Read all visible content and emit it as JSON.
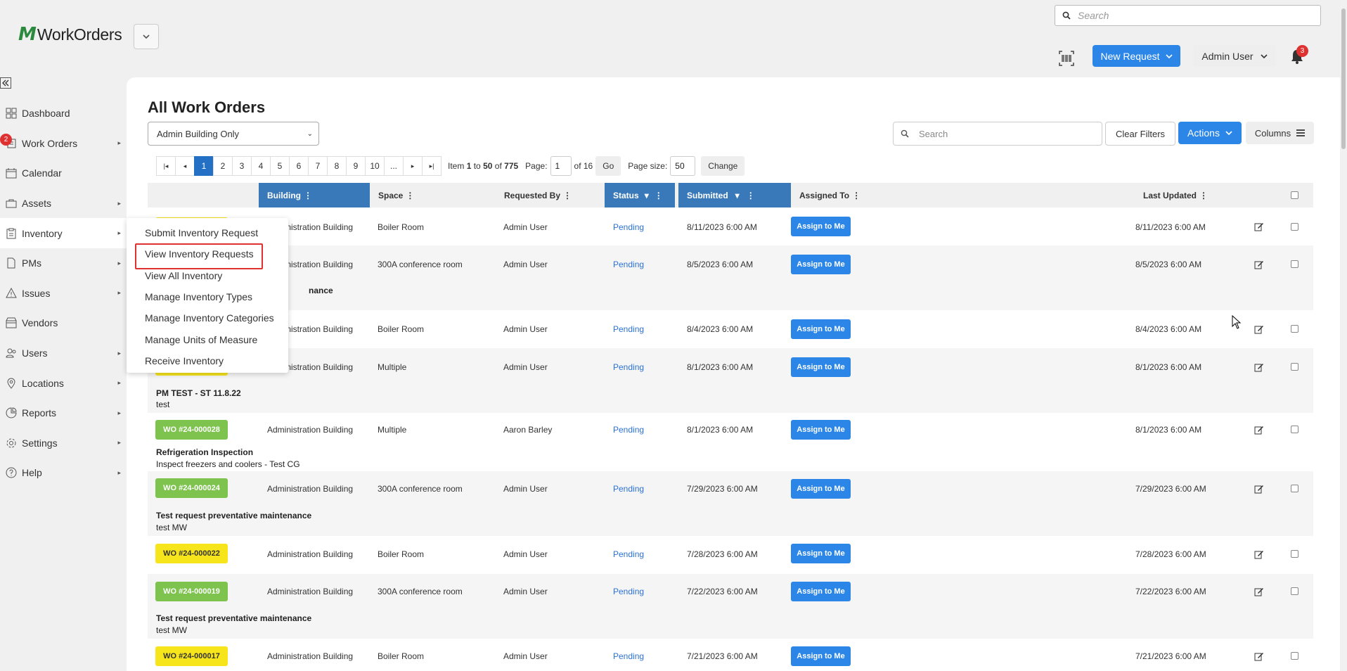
{
  "header": {
    "app_name": "WorkOrders",
    "logo_mark": "M",
    "search_placeholder": "Search",
    "new_request_label": "New Request",
    "user_label": "Admin User",
    "notification_count": "3"
  },
  "sidebar": {
    "items": [
      {
        "label": "Dashboard",
        "icon": "dashboard-icon",
        "arrow": false
      },
      {
        "label": "Work Orders",
        "icon": "work-orders-icon",
        "arrow": true,
        "badge": "2"
      },
      {
        "label": "Calendar",
        "icon": "calendar-icon",
        "arrow": false
      },
      {
        "label": "Assets",
        "icon": "assets-icon",
        "arrow": true
      },
      {
        "label": "Inventory",
        "icon": "inventory-icon",
        "arrow": true,
        "active": true
      },
      {
        "label": "PMs",
        "icon": "pms-icon",
        "arrow": true
      },
      {
        "label": "Issues",
        "icon": "issues-icon",
        "arrow": true
      },
      {
        "label": "Vendors",
        "icon": "vendors-icon",
        "arrow": false
      },
      {
        "label": "Users",
        "icon": "users-icon",
        "arrow": true
      },
      {
        "label": "Locations",
        "icon": "locations-icon",
        "arrow": true
      },
      {
        "label": "Reports",
        "icon": "reports-icon",
        "arrow": true
      },
      {
        "label": "Settings",
        "icon": "settings-icon",
        "arrow": true
      },
      {
        "label": "Help",
        "icon": "help-icon",
        "arrow": true
      }
    ]
  },
  "inventory_menu": {
    "items": [
      {
        "label": "Submit Inventory Request"
      },
      {
        "label": "View Inventory Requests",
        "highlighted": true
      },
      {
        "label": "View All Inventory"
      },
      {
        "label": "Manage Inventory Types"
      },
      {
        "label": "Manage Inventory Categories"
      },
      {
        "label": "Manage Units of Measure"
      },
      {
        "label": "Receive Inventory"
      }
    ]
  },
  "main": {
    "title": "All Work Orders",
    "filter_selected": "Admin Building Only",
    "search_placeholder": "Search",
    "clear_filters_label": "Clear Filters",
    "actions_label": "Actions",
    "columns_label": "Columns"
  },
  "pager": {
    "first": "|◂",
    "prev": "◂",
    "pages": [
      "1",
      "2",
      "3",
      "4",
      "5",
      "6",
      "7",
      "8",
      "9",
      "10",
      "..."
    ],
    "next": "▸",
    "last": "▸|",
    "item_prefix": "Item",
    "item_from": "1",
    "item_to_word": "to",
    "item_to": "50",
    "item_of_word": "of",
    "item_total": "775",
    "page_label": "Page:",
    "page_value": "1",
    "page_of": "of 16",
    "go_label": "Go",
    "size_label": "Page size:",
    "size_value": "50",
    "change_label": "Change"
  },
  "table": {
    "headers": {
      "building": "Building",
      "space": "Space",
      "requested_by": "Requested By",
      "status": "Status",
      "submitted": "Submitted",
      "assigned_to": "Assigned To",
      "last_updated": "Last Updated"
    },
    "assign_label": "Assign to Me",
    "rows": [
      {
        "wo": "",
        "badge_color": "yellow",
        "building": "Administration Building",
        "space": "Boiler Room",
        "requested_by": "Admin User",
        "status": "Pending",
        "submitted": "8/11/2023 6:00 AM",
        "last_updated": "8/11/2023 6:00 AM",
        "title": "",
        "desc": ""
      },
      {
        "wo": "",
        "badge_color": "none",
        "building": "Administration Building",
        "space": "300A conference room",
        "requested_by": "Admin User",
        "status": "Pending",
        "submitted": "8/5/2023 6:00 AM",
        "last_updated": "8/5/2023 6:00 AM",
        "title": "nance",
        "desc": ""
      },
      {
        "wo": "",
        "badge_color": "none",
        "building": "Administration Building",
        "space": "Boiler Room",
        "requested_by": "Admin User",
        "status": "Pending",
        "submitted": "8/4/2023 6:00 AM",
        "last_updated": "8/4/2023 6:00 AM",
        "title": "",
        "desc": ""
      },
      {
        "wo": "",
        "badge_color": "yellow",
        "building": "Administration Building",
        "space": "Multiple",
        "requested_by": "Admin User",
        "status": "Pending",
        "submitted": "8/1/2023 6:00 AM",
        "last_updated": "8/1/2023 6:00 AM",
        "title": "PM TEST - ST 11.8.22",
        "desc": "test"
      },
      {
        "wo": "WO #24-000028",
        "badge_color": "green",
        "building": "Administration Building",
        "space": "Multiple",
        "requested_by": "Aaron Barley",
        "status": "Pending",
        "submitted": "8/1/2023 6:00 AM",
        "last_updated": "8/1/2023 6:00 AM",
        "title": "Refrigeration Inspection",
        "desc": "Inspect freezers and coolers - Test CG"
      },
      {
        "wo": "WO #24-000024",
        "badge_color": "green",
        "building": "Administration Building",
        "space": "300A conference room",
        "requested_by": "Admin User",
        "status": "Pending",
        "submitted": "7/29/2023 6:00 AM",
        "last_updated": "7/29/2023 6:00 AM",
        "title": "Test request preventative maintenance",
        "desc": "test MW"
      },
      {
        "wo": "WO #24-000022",
        "badge_color": "yellow",
        "building": "Administration Building",
        "space": "Boiler Room",
        "requested_by": "Admin User",
        "status": "Pending",
        "submitted": "7/28/2023 6:00 AM",
        "last_updated": "7/28/2023 6:00 AM",
        "title": "",
        "desc": ""
      },
      {
        "wo": "WO #24-000019",
        "badge_color": "green",
        "building": "Administration Building",
        "space": "300A conference room",
        "requested_by": "Admin User",
        "status": "Pending",
        "submitted": "7/22/2023 6:00 AM",
        "last_updated": "7/22/2023 6:00 AM",
        "title": "Test request preventative maintenance",
        "desc": "test MW"
      },
      {
        "wo": "WO #24-000017",
        "badge_color": "yellow",
        "building": "Administration Building",
        "space": "Boiler Room",
        "requested_by": "Admin User",
        "status": "Pending",
        "submitted": "7/21/2023 6:00 AM",
        "last_updated": "7/21/2023 6:00 AM",
        "title": "",
        "desc": ""
      }
    ]
  },
  "colors": {
    "primary": "#2b86e8",
    "header_blue": "#3a79b9",
    "badge_yellow": "#f7e51c",
    "badge_green": "#7dc34e",
    "alert_red": "#e03131",
    "brand_green": "#2b8a3e"
  }
}
